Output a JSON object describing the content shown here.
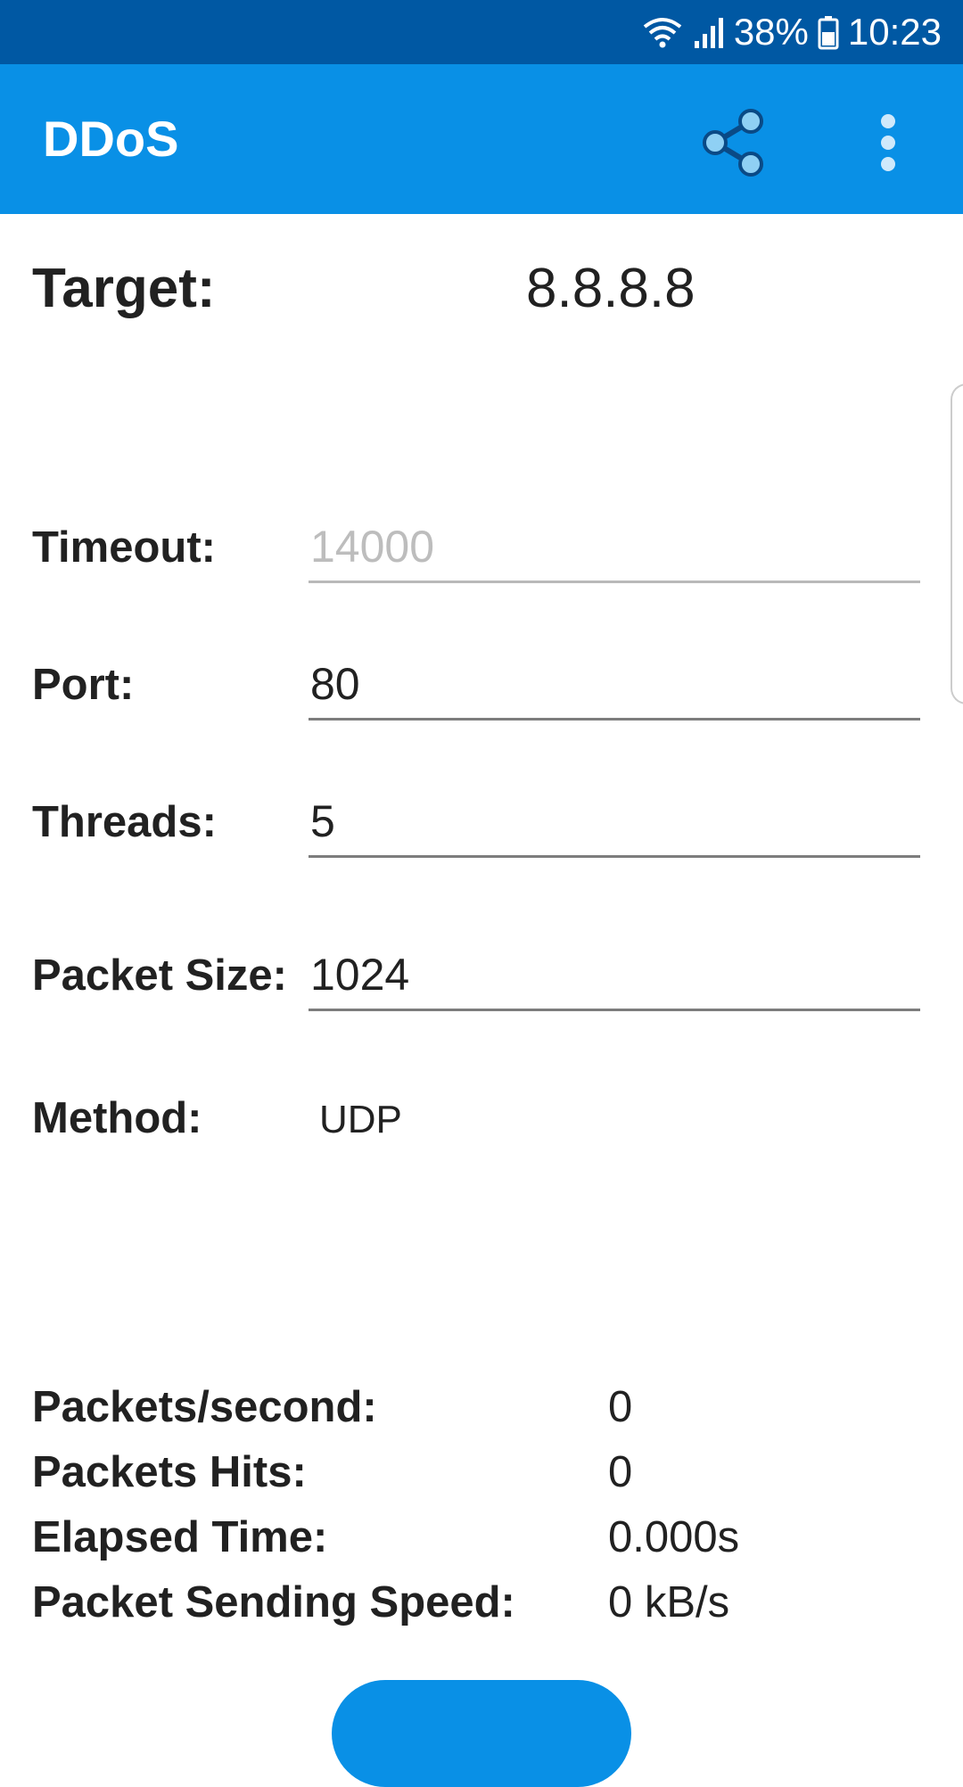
{
  "status_bar": {
    "battery": "38%",
    "time": "10:23",
    "icons": [
      "wifi-icon",
      "signal-icon",
      "battery-icon"
    ]
  },
  "app_bar": {
    "title": "DDoS",
    "actions": [
      "share-icon",
      "more-vert-icon"
    ]
  },
  "target": {
    "label": "Target:",
    "value": "8.8.8.8"
  },
  "form": {
    "timeout": {
      "label": "Timeout:",
      "value": "",
      "placeholder": "14000"
    },
    "port": {
      "label": "Port:",
      "value": "80"
    },
    "threads": {
      "label": "Threads:",
      "value": "5"
    },
    "packet_size": {
      "label": "Packet Size:",
      "value": "1024"
    },
    "method": {
      "label": "Method:",
      "value": "UDP"
    }
  },
  "stats": {
    "packets_per_second": {
      "label": "Packets/second:",
      "value": "0"
    },
    "packets_hits": {
      "label": "Packets Hits:",
      "value": "0"
    },
    "elapsed_time": {
      "label": "Elapsed Time:",
      "value": "0.000s"
    },
    "sending_speed": {
      "label": "Packet Sending Speed:",
      "value": "0 kB/s"
    }
  },
  "colors": {
    "status_bar": "#0058a3",
    "app_bar": "#0990e6",
    "accent": "#0990e6"
  }
}
